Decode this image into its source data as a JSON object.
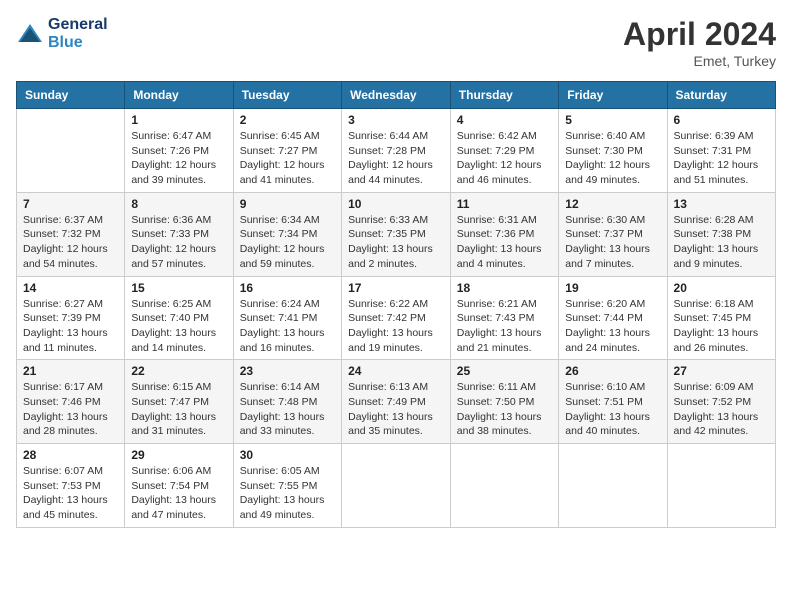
{
  "header": {
    "logo_line1": "General",
    "logo_line2": "Blue",
    "month_year": "April 2024",
    "location": "Emet, Turkey"
  },
  "days_of_week": [
    "Sunday",
    "Monday",
    "Tuesday",
    "Wednesday",
    "Thursday",
    "Friday",
    "Saturday"
  ],
  "weeks": [
    [
      {
        "day": "",
        "info": ""
      },
      {
        "day": "1",
        "info": "Sunrise: 6:47 AM\nSunset: 7:26 PM\nDaylight: 12 hours\nand 39 minutes."
      },
      {
        "day": "2",
        "info": "Sunrise: 6:45 AM\nSunset: 7:27 PM\nDaylight: 12 hours\nand 41 minutes."
      },
      {
        "day": "3",
        "info": "Sunrise: 6:44 AM\nSunset: 7:28 PM\nDaylight: 12 hours\nand 44 minutes."
      },
      {
        "day": "4",
        "info": "Sunrise: 6:42 AM\nSunset: 7:29 PM\nDaylight: 12 hours\nand 46 minutes."
      },
      {
        "day": "5",
        "info": "Sunrise: 6:40 AM\nSunset: 7:30 PM\nDaylight: 12 hours\nand 49 minutes."
      },
      {
        "day": "6",
        "info": "Sunrise: 6:39 AM\nSunset: 7:31 PM\nDaylight: 12 hours\nand 51 minutes."
      }
    ],
    [
      {
        "day": "7",
        "info": "Sunrise: 6:37 AM\nSunset: 7:32 PM\nDaylight: 12 hours\nand 54 minutes."
      },
      {
        "day": "8",
        "info": "Sunrise: 6:36 AM\nSunset: 7:33 PM\nDaylight: 12 hours\nand 57 minutes."
      },
      {
        "day": "9",
        "info": "Sunrise: 6:34 AM\nSunset: 7:34 PM\nDaylight: 12 hours\nand 59 minutes."
      },
      {
        "day": "10",
        "info": "Sunrise: 6:33 AM\nSunset: 7:35 PM\nDaylight: 13 hours\nand 2 minutes."
      },
      {
        "day": "11",
        "info": "Sunrise: 6:31 AM\nSunset: 7:36 PM\nDaylight: 13 hours\nand 4 minutes."
      },
      {
        "day": "12",
        "info": "Sunrise: 6:30 AM\nSunset: 7:37 PM\nDaylight: 13 hours\nand 7 minutes."
      },
      {
        "day": "13",
        "info": "Sunrise: 6:28 AM\nSunset: 7:38 PM\nDaylight: 13 hours\nand 9 minutes."
      }
    ],
    [
      {
        "day": "14",
        "info": "Sunrise: 6:27 AM\nSunset: 7:39 PM\nDaylight: 13 hours\nand 11 minutes."
      },
      {
        "day": "15",
        "info": "Sunrise: 6:25 AM\nSunset: 7:40 PM\nDaylight: 13 hours\nand 14 minutes."
      },
      {
        "day": "16",
        "info": "Sunrise: 6:24 AM\nSunset: 7:41 PM\nDaylight: 13 hours\nand 16 minutes."
      },
      {
        "day": "17",
        "info": "Sunrise: 6:22 AM\nSunset: 7:42 PM\nDaylight: 13 hours\nand 19 minutes."
      },
      {
        "day": "18",
        "info": "Sunrise: 6:21 AM\nSunset: 7:43 PM\nDaylight: 13 hours\nand 21 minutes."
      },
      {
        "day": "19",
        "info": "Sunrise: 6:20 AM\nSunset: 7:44 PM\nDaylight: 13 hours\nand 24 minutes."
      },
      {
        "day": "20",
        "info": "Sunrise: 6:18 AM\nSunset: 7:45 PM\nDaylight: 13 hours\nand 26 minutes."
      }
    ],
    [
      {
        "day": "21",
        "info": "Sunrise: 6:17 AM\nSunset: 7:46 PM\nDaylight: 13 hours\nand 28 minutes."
      },
      {
        "day": "22",
        "info": "Sunrise: 6:15 AM\nSunset: 7:47 PM\nDaylight: 13 hours\nand 31 minutes."
      },
      {
        "day": "23",
        "info": "Sunrise: 6:14 AM\nSunset: 7:48 PM\nDaylight: 13 hours\nand 33 minutes."
      },
      {
        "day": "24",
        "info": "Sunrise: 6:13 AM\nSunset: 7:49 PM\nDaylight: 13 hours\nand 35 minutes."
      },
      {
        "day": "25",
        "info": "Sunrise: 6:11 AM\nSunset: 7:50 PM\nDaylight: 13 hours\nand 38 minutes."
      },
      {
        "day": "26",
        "info": "Sunrise: 6:10 AM\nSunset: 7:51 PM\nDaylight: 13 hours\nand 40 minutes."
      },
      {
        "day": "27",
        "info": "Sunrise: 6:09 AM\nSunset: 7:52 PM\nDaylight: 13 hours\nand 42 minutes."
      }
    ],
    [
      {
        "day": "28",
        "info": "Sunrise: 6:07 AM\nSunset: 7:53 PM\nDaylight: 13 hours\nand 45 minutes."
      },
      {
        "day": "29",
        "info": "Sunrise: 6:06 AM\nSunset: 7:54 PM\nDaylight: 13 hours\nand 47 minutes."
      },
      {
        "day": "30",
        "info": "Sunrise: 6:05 AM\nSunset: 7:55 PM\nDaylight: 13 hours\nand 49 minutes."
      },
      {
        "day": "",
        "info": ""
      },
      {
        "day": "",
        "info": ""
      },
      {
        "day": "",
        "info": ""
      },
      {
        "day": "",
        "info": ""
      }
    ]
  ]
}
